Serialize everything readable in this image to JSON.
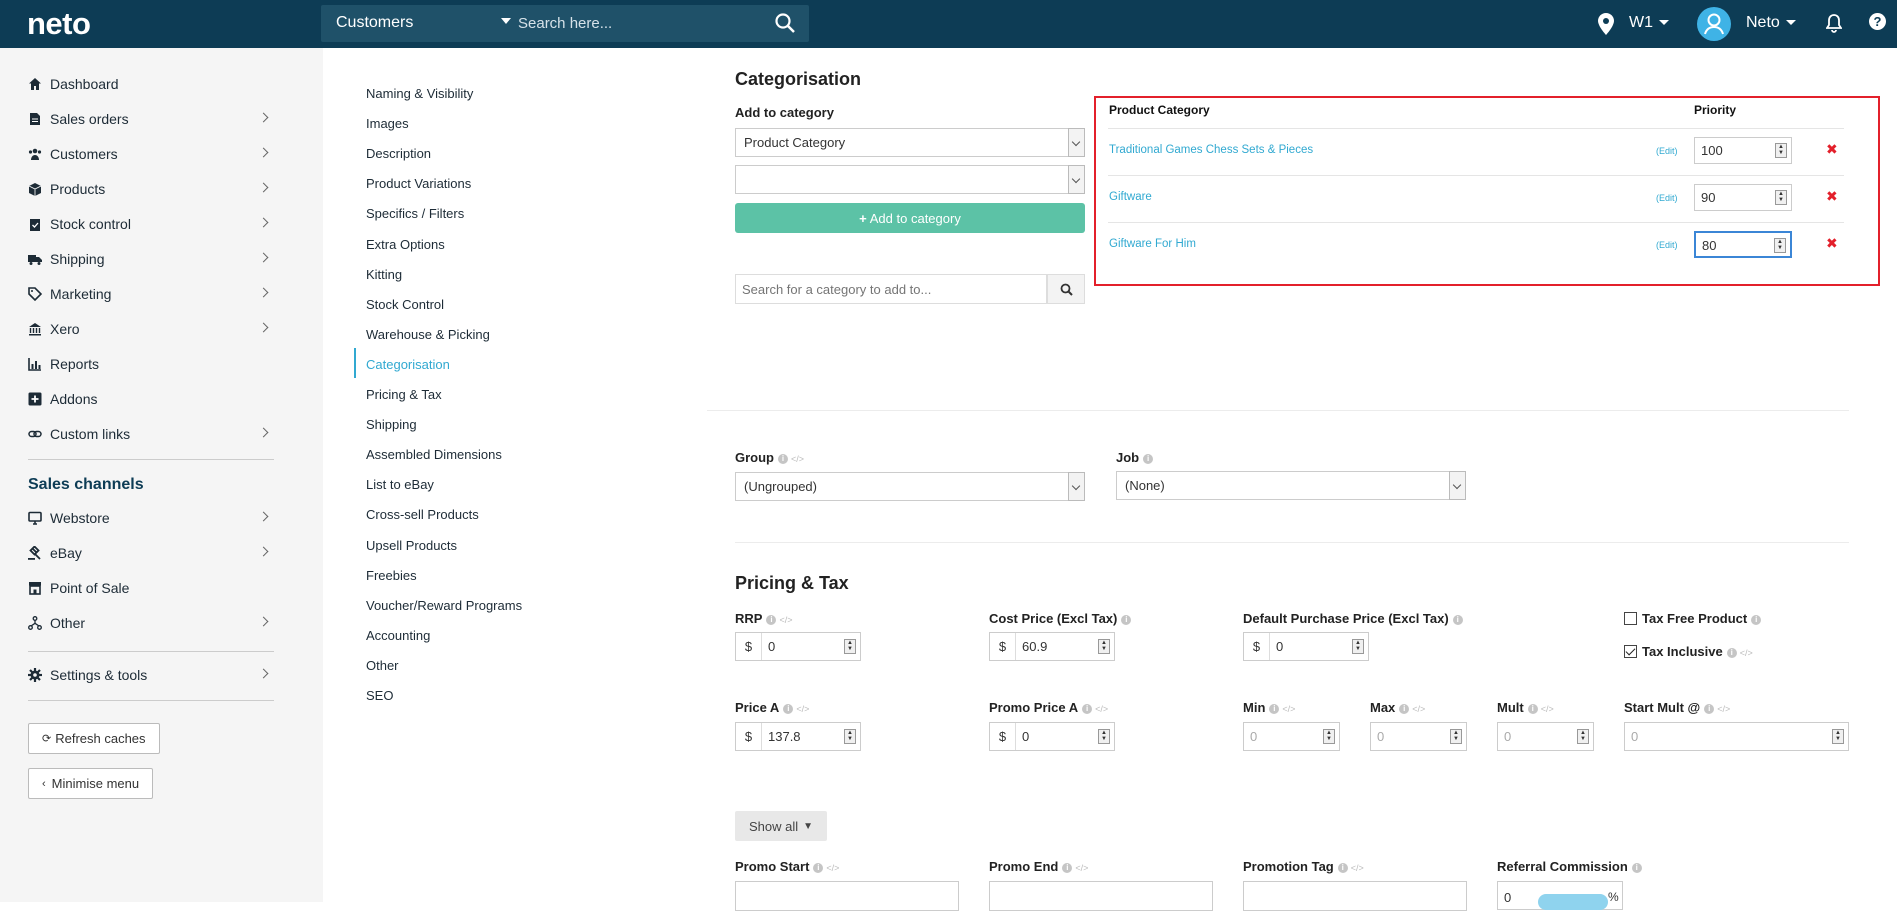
{
  "topbar": {
    "logo": "neto",
    "search_scope": "Customers",
    "search_placeholder": "Search here...",
    "location": "W1",
    "user": "Neto",
    "help": "?"
  },
  "sidebar": {
    "items": [
      {
        "label": "Dashboard",
        "icon": "home-icon"
      },
      {
        "label": "Sales orders",
        "icon": "document-icon"
      },
      {
        "label": "Customers",
        "icon": "users-icon"
      },
      {
        "label": "Products",
        "icon": "box-icon"
      },
      {
        "label": "Stock control",
        "icon": "clipboard-icon"
      },
      {
        "label": "Shipping",
        "icon": "truck-icon"
      },
      {
        "label": "Marketing",
        "icon": "tag-icon"
      },
      {
        "label": "Xero",
        "icon": "bank-icon"
      },
      {
        "label": "Reports",
        "icon": "chart-icon"
      },
      {
        "label": "Addons",
        "icon": "plus-square-icon"
      },
      {
        "label": "Custom links",
        "icon": "link-icon"
      }
    ],
    "sales_channels_title": "Sales channels",
    "channels": [
      {
        "label": "Webstore",
        "icon": "monitor-icon"
      },
      {
        "label": "eBay",
        "icon": "gavel-icon"
      },
      {
        "label": "Point of Sale",
        "icon": "store-icon"
      },
      {
        "label": "Other",
        "icon": "network-icon"
      }
    ],
    "settings": "Settings & tools",
    "refresh_caches": "Refresh caches",
    "minimise_menu": "Minimise menu"
  },
  "subnav": {
    "items": [
      "Naming & Visibility",
      "Images",
      "Description",
      "Product Variations",
      "Specifics / Filters",
      "Extra Options",
      "Kitting",
      "Stock Control",
      "Warehouse & Picking",
      "Categorisation",
      "Pricing & Tax",
      "Shipping",
      "Assembled Dimensions",
      "List to eBay",
      "Cross-sell Products",
      "Upsell Products",
      "Freebies",
      "Voucher/Reward Programs",
      "Accounting",
      "Other",
      "SEO"
    ],
    "active": "Categorisation"
  },
  "categorisation": {
    "title": "Categorisation",
    "add_to_category_label": "Add to category",
    "category_select": "Product Category",
    "subcategory_select": "",
    "add_button": "Add to category",
    "search_placeholder": "Search for a category to add to...",
    "table_header_category": "Product Category",
    "table_header_priority": "Priority",
    "edit_label": "(Edit)",
    "rows": [
      {
        "category": "Traditional Games Chess Sets & Pieces",
        "priority": "100"
      },
      {
        "category": "Giftware",
        "priority": "90"
      },
      {
        "category": "Giftware For Him",
        "priority": "80"
      }
    ]
  },
  "group_job": {
    "group_label": "Group",
    "group_value": "(Ungrouped)",
    "job_label": "Job",
    "job_value": "(None)"
  },
  "pricing": {
    "title": "Pricing & Tax",
    "rrp_label": "RRP",
    "rrp": "0",
    "cost_label": "Cost Price (Excl Tax)",
    "cost": "60.9",
    "default_purchase_label": "Default Purchase Price (Excl Tax)",
    "default_purchase": "0",
    "tax_free_label": "Tax Free Product",
    "tax_inclusive_label": "Tax Inclusive",
    "price_a_label": "Price A",
    "price_a": "137.8",
    "promo_price_label": "Promo Price A",
    "promo_price": "0",
    "min_label": "Min",
    "min": "0",
    "max_label": "Max",
    "max": "0",
    "mult_label": "Mult",
    "mult": "0",
    "start_mult_label": "Start Mult @",
    "start_mult": "0",
    "currency": "$",
    "show_all": "Show all",
    "promo_start_label": "Promo Start",
    "promo_end_label": "Promo End",
    "promotion_tag_label": "Promotion Tag",
    "referral_label": "Referral Commission",
    "referral_value": "0",
    "percent": "%"
  },
  "colors": {
    "topbar": "#0d3c55",
    "accent": "#31a9d1",
    "green": "#5cc2a6",
    "highlight": "#e3202b"
  }
}
